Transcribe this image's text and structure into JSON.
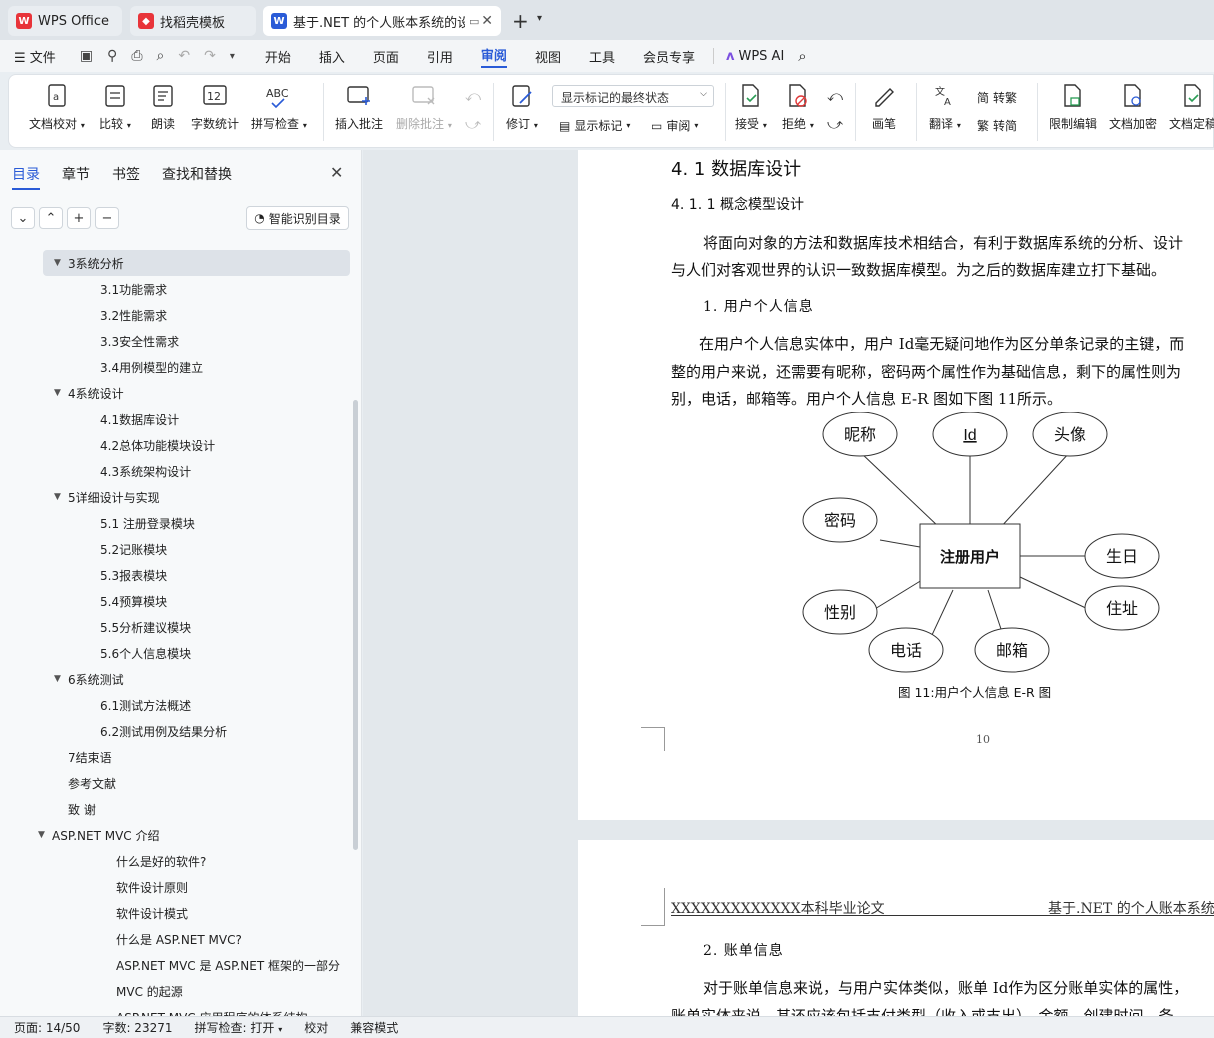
{
  "tabs": [
    {
      "label": "WPS Office",
      "icon": "wps-logo"
    },
    {
      "label": "找稻壳模板",
      "icon": "docer-logo"
    },
    {
      "label": "基于.NET 的个人账本系统的设",
      "icon": "writer-logo"
    }
  ],
  "menu": {
    "file": "文件",
    "items": [
      "开始",
      "插入",
      "页面",
      "引用",
      "审阅",
      "视图",
      "工具",
      "会员专享"
    ],
    "active": "审阅",
    "ai": "WPS AI"
  },
  "ribbon": {
    "proofread": "文档校对",
    "compare": "比较",
    "read_aloud": "朗读",
    "word_count": "字数统计",
    "spell_check": "拼写检查",
    "insert_comment": "插入批注",
    "delete_comment": "删除批注",
    "track": "修订",
    "markup_select": "显示标记的最终状态",
    "show_markup": "显示标记",
    "review": "审阅",
    "accept": "接受",
    "reject": "拒绝",
    "ink": "画笔",
    "translate": "翻译",
    "to_traditional": "转繁",
    "to_simplified": "转简",
    "restrict": "限制编辑",
    "encrypt": "文档加密",
    "finalize": "文档定稿",
    "word_count_icon_text": "12",
    "spell_icon_text": "ABC"
  },
  "nav": {
    "tabs": [
      "目录",
      "章节",
      "书签",
      "查找和替换"
    ],
    "smart_toc": "智能识别目录",
    "toc": [
      {
        "label": "3系统分析",
        "level": 1,
        "expanded": true,
        "selected": true
      },
      {
        "label": "3.1功能需求",
        "level": 2
      },
      {
        "label": "3.2性能需求",
        "level": 2
      },
      {
        "label": "3.3安全性需求",
        "level": 2
      },
      {
        "label": "3.4用例模型的建立",
        "level": 2
      },
      {
        "label": "4系统设计",
        "level": 1,
        "expanded": true
      },
      {
        "label": "4.1数据库设计",
        "level": 2
      },
      {
        "label": "4.2总体功能模块设计",
        "level": 2
      },
      {
        "label": "4.3系统架构设计",
        "level": 2
      },
      {
        "label": "5详细设计与实现",
        "level": 1,
        "expanded": true
      },
      {
        "label": "5.1 注册登录模块",
        "level": 2
      },
      {
        "label": "5.2记账模块",
        "level": 2
      },
      {
        "label": "5.3报表模块",
        "level": 2
      },
      {
        "label": "5.4预算模块",
        "level": 2
      },
      {
        "label": "5.5分析建议模块",
        "level": 2
      },
      {
        "label": "5.6个人信息模块",
        "level": 2
      },
      {
        "label": "6系统测试",
        "level": 1,
        "expanded": true
      },
      {
        "label": "6.1测试方法概述",
        "level": 2
      },
      {
        "label": "6.2测试用例及结果分析",
        "level": 2
      },
      {
        "label": "7结束语",
        "level": 1
      },
      {
        "label": "参考文献",
        "level": 1
      },
      {
        "label": "致  谢",
        "level": 1
      },
      {
        "label": "ASP.NET MVC 介绍",
        "level": 0,
        "expanded": true
      },
      {
        "label": "什么是好的软件?",
        "level": 3
      },
      {
        "label": "软件设计原则",
        "level": 3
      },
      {
        "label": "软件设计模式",
        "level": 3
      },
      {
        "label": "什么是 ASP.NET MVC?",
        "level": 3
      },
      {
        "label": "ASP.NET MVC 是 ASP.NET 框架的一部分",
        "level": 3
      },
      {
        "label": "MVC 的起源",
        "level": 3
      },
      {
        "label": "ASP.NET MVC 应用程序的体系结构",
        "level": 3
      }
    ]
  },
  "doc": {
    "heading": "4. 1 数据库设计",
    "subheading": "4. 1. 1 概念模型设计",
    "para1_line1": "将面向对象的方法和数据库技术相结合，有利于数据库系统的分析、设计",
    "para1_line2": "与人们对客观世界的认识一致数据库模型。为之后的数据库建立打下基础。",
    "item1": "1. 用户个人信息",
    "para2_line1": "在用户个人信息实体中，用户  Id毫无疑问地作为区分单条记录的主键，而",
    "para2_line2": "整的用户来说，还需要有昵称，密码两个属性作为基础信息，剩下的属性则为",
    "para2_line3": "别，电话，邮箱等。用户个人信息  E-R 图如下图  11所示。",
    "er": {
      "entity": "注册用户",
      "attributes": [
        "昵称",
        "Id",
        "头像",
        "密码",
        "生日",
        "性别",
        "住址",
        "电话",
        "邮箱"
      ],
      "key": "Id"
    },
    "caption": "图  11:用户个人信息  E-R  图",
    "page_number": "10",
    "header_left": "XXXXXXXXXXXXX本科毕业论文",
    "header_right": "基于.NET 的个人账本系统的",
    "item2": "2. 账单信息",
    "para3_line1": "对于账单信息来说，与用户实体类似，账单  Id作为区分账单实体的属性，",
    "para3_line2": "账单实体来说，其还应该包括支付类型（收入或支出），金额，创建时间，备"
  },
  "status": {
    "page": "页面: 14/50",
    "words": "字数: 23271",
    "spell": "拼写检查: 打开",
    "proof": "校对",
    "compat": "兼容模式"
  }
}
